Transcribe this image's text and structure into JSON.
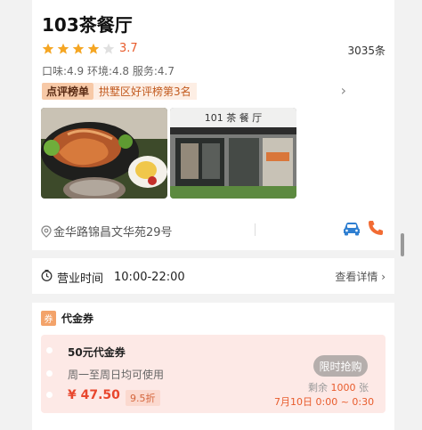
{
  "restaurant": {
    "name": "103茶餐厅",
    "rating": "3.7",
    "stars_filled": 4,
    "stars_total": 5,
    "review_count": "3035条",
    "scores": "口味:4.9 环境:4.8 服务:4.7",
    "rank_tag": "点评榜单",
    "rank_text": "拱墅区好评榜第3名",
    "address": "金华路锦昌文华苑29号"
  },
  "photos": {
    "photo2_sign": "101 茶 餐 厅"
  },
  "hours": {
    "label": "营业时间",
    "time": "10:00-22:00",
    "detail_link": "查看详情 ›"
  },
  "voucher": {
    "section_badge": "券",
    "section_title": "代金券",
    "title": "50元代金券",
    "subtitle": "周一至周日均可使用",
    "price": "¥ 47.50",
    "discount": "9.5折",
    "button": "限时抢购",
    "remain_prefix": "剩余",
    "remain_count": "1000",
    "remain_suffix": "张",
    "time": "7月10日 0:00 ~ 0:30"
  },
  "colors": {
    "accent": "#e85c2c",
    "star": "#f5a623",
    "phone": "#f26b33",
    "car": "#2f7fd1"
  },
  "icons": [
    "star-icon",
    "chevron-right-icon",
    "location-pin-icon",
    "car-icon",
    "phone-icon",
    "clock-icon"
  ]
}
